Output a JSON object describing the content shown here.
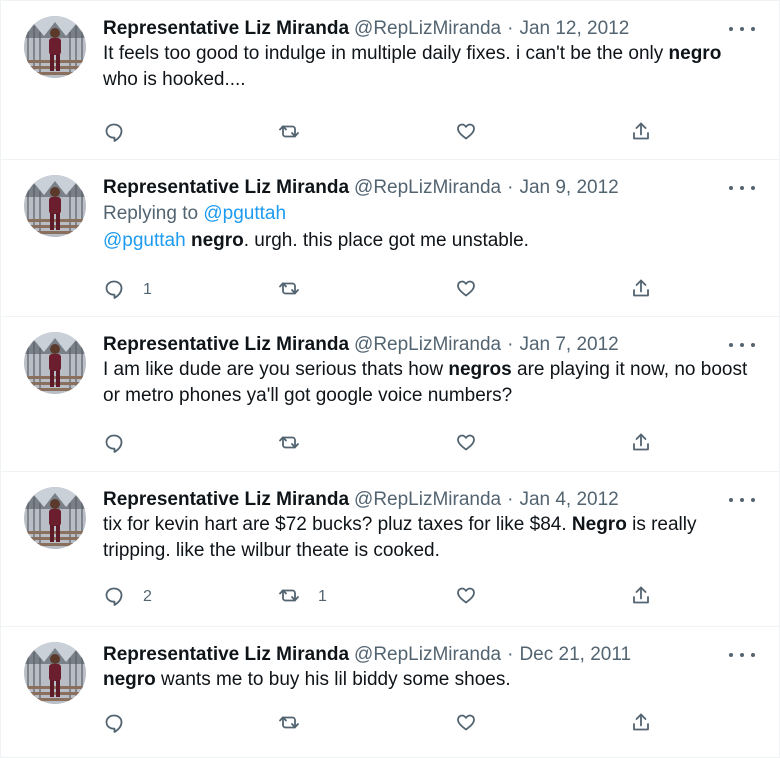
{
  "author": {
    "name": "Representative Liz Miranda",
    "handle": "@RepLizMiranda"
  },
  "separator": "·",
  "tweets": [
    {
      "date": "Jan 12, 2012",
      "reply_label": "",
      "reply_handle": "",
      "segments": [
        {
          "t": "It feels too good to indulge in multiple daily fixes. i can't be the only ",
          "b": false,
          "link": false
        },
        {
          "t": "negro",
          "b": true,
          "link": false
        },
        {
          "t": " who is hooked....",
          "b": false,
          "link": false
        }
      ],
      "replies": "",
      "retweets": ""
    },
    {
      "date": "Jan 9, 2012",
      "reply_label": "Replying to ",
      "reply_handle": "@pguttah",
      "segments": [
        {
          "t": "@pguttah",
          "b": false,
          "link": true
        },
        {
          "t": " ",
          "b": false,
          "link": false
        },
        {
          "t": "negro",
          "b": true,
          "link": false
        },
        {
          "t": ". urgh. this place got me unstable.",
          "b": false,
          "link": false
        }
      ],
      "replies": "1",
      "retweets": ""
    },
    {
      "date": "Jan 7, 2012",
      "reply_label": "",
      "reply_handle": "",
      "segments": [
        {
          "t": "I am like dude are you serious thats how ",
          "b": false,
          "link": false
        },
        {
          "t": "negros",
          "b": true,
          "link": false
        },
        {
          "t": " are playing it now, no boost or metro phones ya'll got google voice numbers?",
          "b": false,
          "link": false
        }
      ],
      "replies": "",
      "retweets": ""
    },
    {
      "date": "Jan 4, 2012",
      "reply_label": "",
      "reply_handle": "",
      "segments": [
        {
          "t": "tix for kevin hart are $72 bucks? pluz taxes for like $84. ",
          "b": false,
          "link": false
        },
        {
          "t": "Negro",
          "b": true,
          "link": false
        },
        {
          "t": " is really tripping. like the wilbur theate is cooked.",
          "b": false,
          "link": false
        }
      ],
      "replies": "2",
      "retweets": "1"
    },
    {
      "date": "Dec 21, 2011",
      "reply_label": "",
      "reply_handle": "",
      "segments": [
        {
          "t": "negro",
          "b": true,
          "link": false
        },
        {
          "t": " wants me to buy his lil biddy some shoes.",
          "b": false,
          "link": false
        }
      ],
      "replies": "",
      "retweets": ""
    }
  ],
  "icons": {
    "reply": "speech-bubble-icon",
    "retweet": "retweet-arrows-icon",
    "like": "heart-icon",
    "share": "share-upload-icon",
    "more": "more-dots-icon"
  },
  "colors": {
    "link": "#1d9bf0",
    "muted": "#536471",
    "text": "#0f1419",
    "border": "#eff3f4"
  }
}
